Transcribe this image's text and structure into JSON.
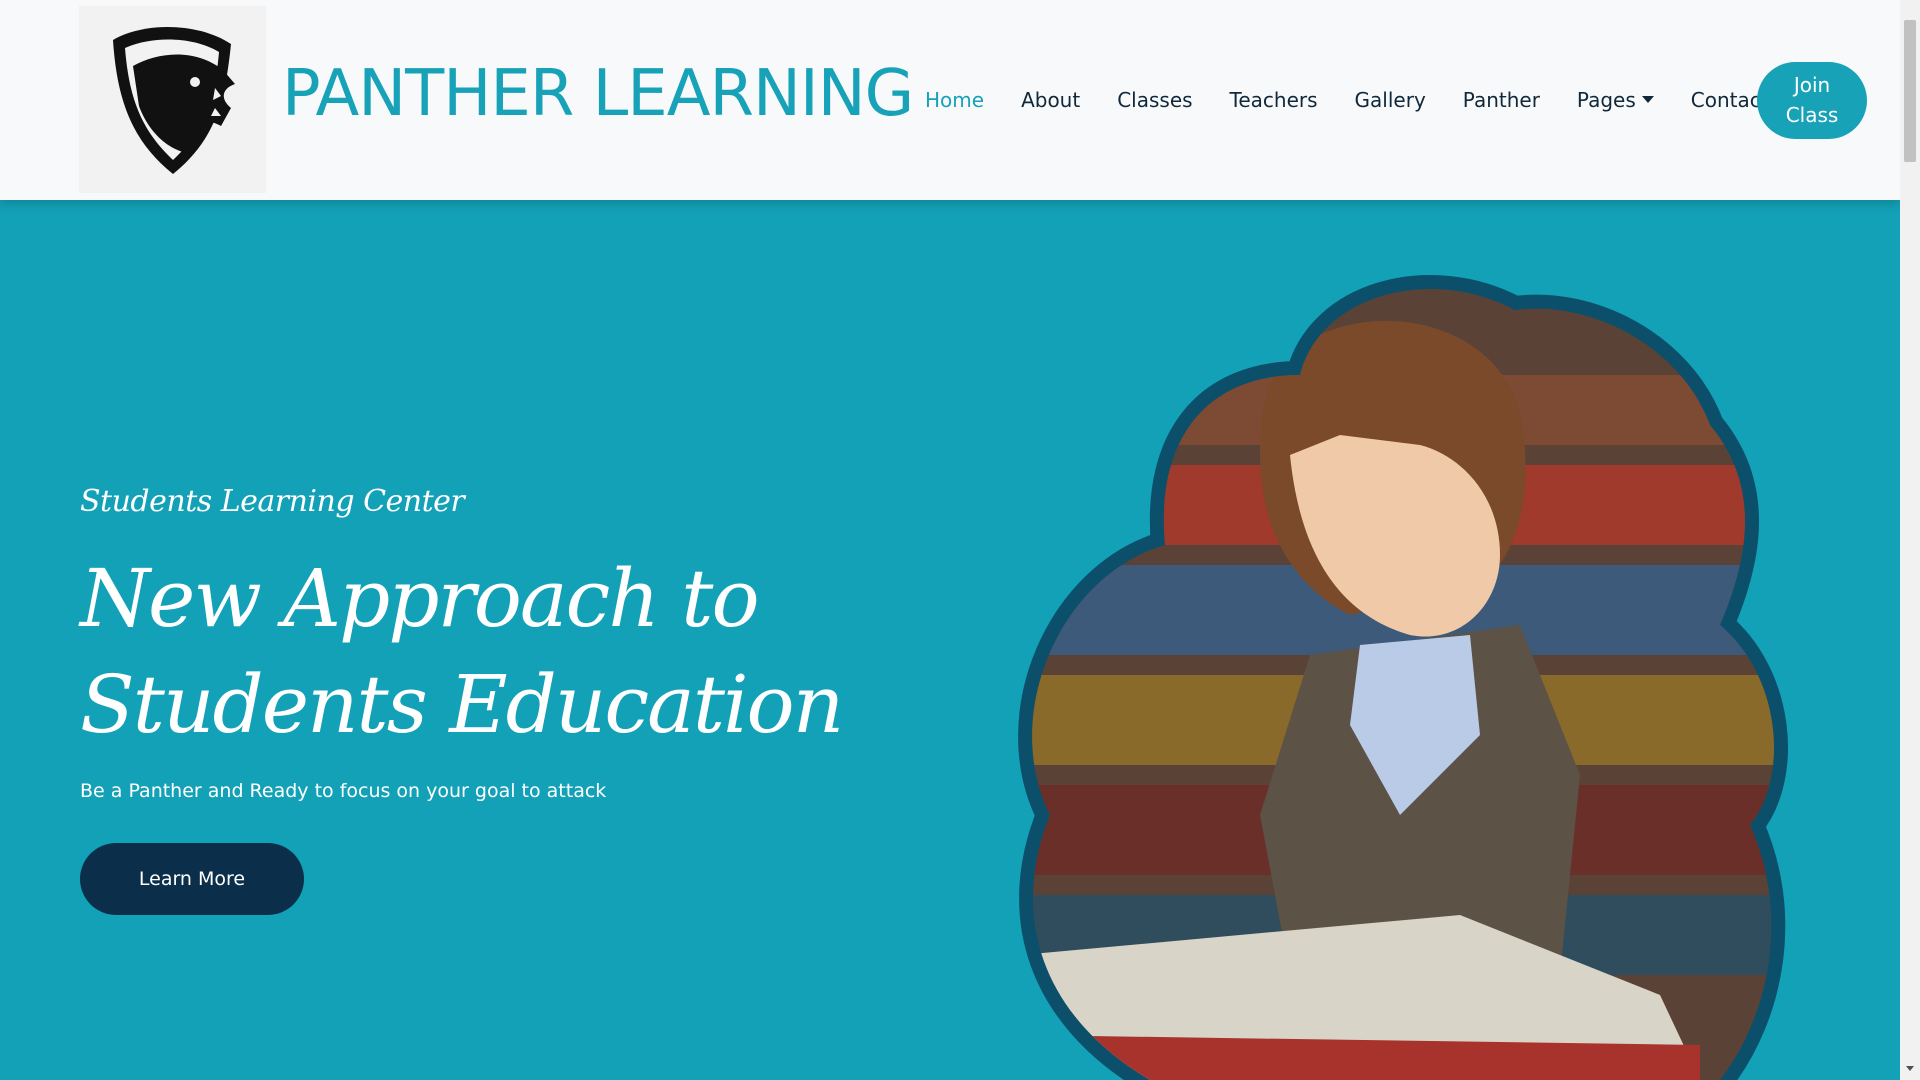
{
  "brand": {
    "name": "PANTHER LEARNING",
    "color": "#17a2b8"
  },
  "nav": {
    "items": [
      {
        "label": "Home",
        "active": true
      },
      {
        "label": "About",
        "active": false
      },
      {
        "label": "Classes",
        "active": false
      },
      {
        "label": "Teachers",
        "active": false
      },
      {
        "label": "Gallery",
        "active": false
      },
      {
        "label": "Panther",
        "active": false
      },
      {
        "label": "Pages",
        "active": false,
        "dropdown": true
      },
      {
        "label": "Contact",
        "active": false
      }
    ],
    "join_line1": "Join",
    "join_line2": "Class"
  },
  "hero": {
    "subtitle": "Students Learning Center",
    "headline_line1": "New Approach to",
    "headline_line2": "Students Education",
    "tagline": "Be a Panther and Ready to focus on your goal to attack",
    "cta": "Learn More",
    "background_color": "#13a1b8",
    "cta_color": "#0b2f4a"
  },
  "icons": {
    "logo": "panther-shield-logo",
    "caret": "caret-down-icon"
  }
}
